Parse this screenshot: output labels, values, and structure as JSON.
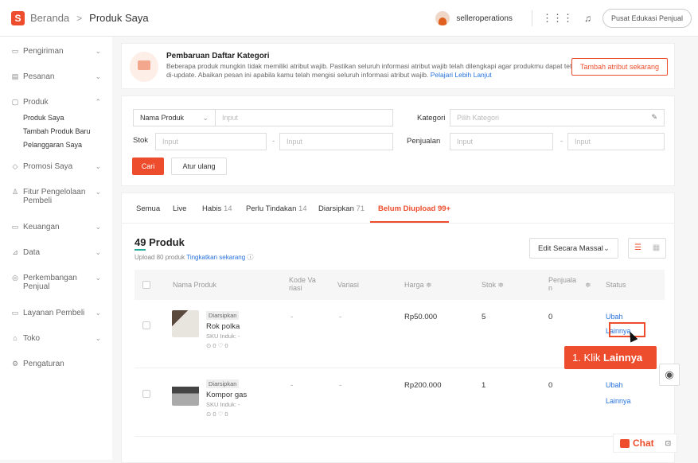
{
  "header": {
    "logo": "S",
    "breadcrumb_home": "Beranda",
    "breadcrumb_sep": ">",
    "breadcrumb_current": "Produk Saya",
    "username": "selleroperations",
    "edu_button": "Pusat Edukasi Penjual"
  },
  "sidebar": {
    "items": [
      {
        "label": "Pengiriman",
        "icon": "truck-icon"
      },
      {
        "label": "Pesanan",
        "icon": "clipboard-icon"
      },
      {
        "label": "Produk",
        "icon": "box-icon",
        "expanded": true,
        "sub": [
          "Produk Saya",
          "Tambah Produk Baru",
          "Pelanggaran Saya"
        ]
      },
      {
        "label": "Promosi Saya",
        "icon": "tag-icon"
      },
      {
        "label": "Fitur Pengelolaan Pembeli",
        "icon": "users-icon"
      },
      {
        "label": "Keuangan",
        "icon": "wallet-icon"
      },
      {
        "label": "Data",
        "icon": "chart-icon"
      },
      {
        "label": "Perkembangan Penjual",
        "icon": "award-icon"
      },
      {
        "label": "Layanan Pembeli",
        "icon": "headset-icon"
      },
      {
        "label": "Toko",
        "icon": "store-icon"
      },
      {
        "label": "Pengaturan",
        "icon": "gear-icon"
      }
    ]
  },
  "banner": {
    "title": "Pembaruan Daftar Kategori",
    "text": "Beberapa produk mungkin tidak memiliki atribut wajib. Pastikan seluruh informasi atribut wajib telah dilengkapi agar produkmu dapat tetap di-update. Abaikan pesan ini apabila kamu telah mengisi seluruh informasi atribut wajib.",
    "link": "Pelajari Lebih Lanjut",
    "button": "Tambah atribut sekarang"
  },
  "filter": {
    "product_select": "Nama Produk",
    "input_placeholder": "Input",
    "category_label": "Kategori",
    "category_placeholder": "Pilih Kategori",
    "stock_label": "Stok",
    "sales_label": "Penjualan",
    "dash": "-",
    "search_button": "Cari",
    "reset_button": "Atur ulang"
  },
  "tabs": [
    {
      "label": "Semua",
      "count": ""
    },
    {
      "label": "Live",
      "count": ""
    },
    {
      "label": "Habis",
      "count": "14"
    },
    {
      "label": "Perlu Tindakan",
      "count": "14"
    },
    {
      "label": "Diarsipkan",
      "count": "71"
    },
    {
      "label": "Belum Diupload 99+",
      "count": ""
    }
  ],
  "list": {
    "count_title": "49 Produk",
    "upload_text": "Upload 80 produk",
    "upload_link": "Tingkatkan sekarang",
    "edit_button": "Edit Secara Massal",
    "columns": [
      "Nama Produk",
      "Kode Va riasi",
      "Variasi",
      "Harga ≑",
      "Stok ≑",
      "Penjuala n",
      "≑",
      "Status"
    ],
    "rows": [
      {
        "badge": "Diarsipkan",
        "name": "Rok polka",
        "sku": "SKU Induk: -",
        "stats": "⊙ 0   ♡ 0",
        "code": "-",
        "variant": "-",
        "price": "Rp50.000",
        "stock": "5",
        "sales": "0",
        "action1": "Ubah",
        "action2": "Lainnya"
      },
      {
        "badge": "Diarsipkan",
        "name": "Kompor gas",
        "sku": "SKU Induk: -",
        "stats": "⊙ 0   ♡ 0",
        "code": "-",
        "variant": "-",
        "price": "Rp200.000",
        "stock": "1",
        "sales": "0",
        "action1": "Ubah",
        "action2": "Lainnya"
      }
    ]
  },
  "callout": {
    "prefix": "1. Klik",
    "bold": "Lainnya"
  },
  "chat": {
    "label": "Chat"
  },
  "colors": {
    "accent": "#ee4d2d",
    "link": "#2673dd"
  }
}
